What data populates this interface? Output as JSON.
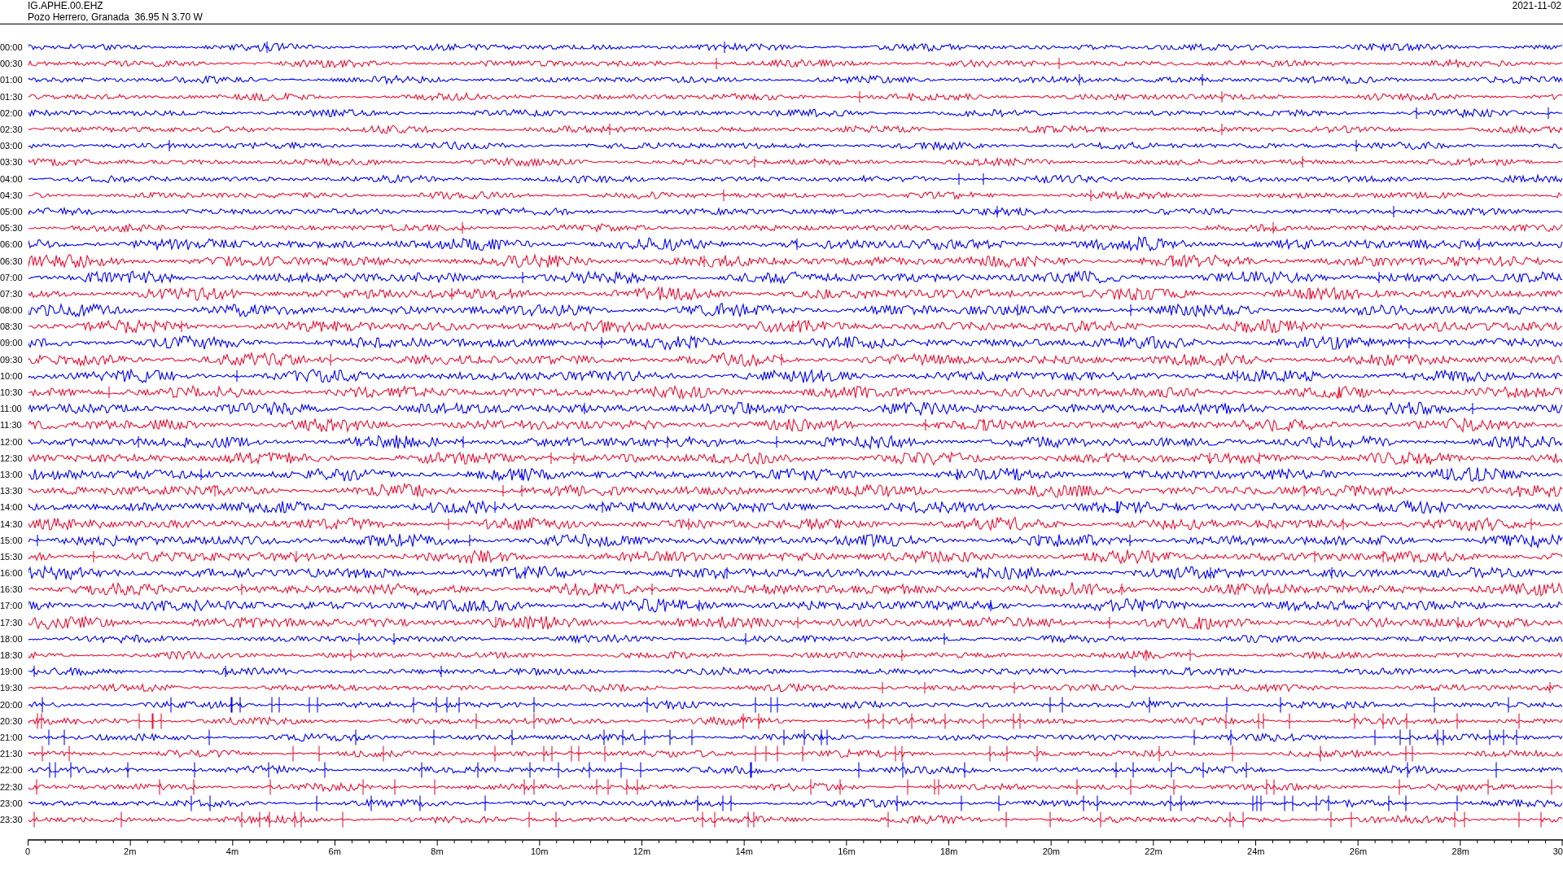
{
  "header": {
    "station": "IG.APHE.00.EHZ",
    "location": "Pozo Herrero, Granada  36.95 N 3.70 W",
    "date": "2021-11-02"
  },
  "traces": [
    {
      "time": "00:00",
      "color": "#0000ff"
    },
    {
      "time": "00:30",
      "color": "#ee1133"
    },
    {
      "time": "01:00",
      "color": "#0000ff"
    },
    {
      "time": "01:30",
      "color": "#ee1133"
    },
    {
      "time": "02:00",
      "color": "#0000ff"
    },
    {
      "time": "02:30",
      "color": "#ee1133"
    },
    {
      "time": "03:00",
      "color": "#0000ff"
    },
    {
      "time": "03:30",
      "color": "#ee1133"
    },
    {
      "time": "04:00",
      "color": "#0000ff"
    },
    {
      "time": "04:30",
      "color": "#ee1133"
    },
    {
      "time": "05:00",
      "color": "#0000ff"
    },
    {
      "time": "05:30",
      "color": "#ee1133"
    },
    {
      "time": "06:00",
      "color": "#0000ff"
    },
    {
      "time": "06:30",
      "color": "#ee1133"
    },
    {
      "time": "07:00",
      "color": "#0000ff"
    },
    {
      "time": "07:30",
      "color": "#ee1133"
    },
    {
      "time": "08:00",
      "color": "#0000ff"
    },
    {
      "time": "08:30",
      "color": "#ee1133"
    },
    {
      "time": "09:00",
      "color": "#0000ff"
    },
    {
      "time": "09:30",
      "color": "#ee1133"
    },
    {
      "time": "10:00",
      "color": "#0000ff"
    },
    {
      "time": "10:30",
      "color": "#ee1133"
    },
    {
      "time": "11:00",
      "color": "#0000ff"
    },
    {
      "time": "11:30",
      "color": "#ee1133"
    },
    {
      "time": "12:00",
      "color": "#0000ff"
    },
    {
      "time": "12:30",
      "color": "#ee1133"
    },
    {
      "time": "13:00",
      "color": "#0000ff"
    },
    {
      "time": "13:30",
      "color": "#ee1133"
    },
    {
      "time": "14:00",
      "color": "#0000ff"
    },
    {
      "time": "14:30",
      "color": "#ee1133"
    },
    {
      "time": "15:00",
      "color": "#0000ff"
    },
    {
      "time": "15:30",
      "color": "#ee1133"
    },
    {
      "time": "16:00",
      "color": "#0000ff"
    },
    {
      "time": "16:30",
      "color": "#ee1133"
    },
    {
      "time": "17:00",
      "color": "#0000ff"
    },
    {
      "time": "17:30",
      "color": "#ee1133"
    },
    {
      "time": "18:00",
      "color": "#0000ff"
    },
    {
      "time": "18:30",
      "color": "#ee1133"
    },
    {
      "time": "19:00",
      "color": "#0000ff"
    },
    {
      "time": "19:30",
      "color": "#ee1133"
    },
    {
      "time": "20:00",
      "color": "#0000ff"
    },
    {
      "time": "20:30",
      "color": "#ee1133"
    },
    {
      "time": "21:00",
      "color": "#0000ff"
    },
    {
      "time": "21:30",
      "color": "#ee1133"
    },
    {
      "time": "22:00",
      "color": "#0000ff"
    },
    {
      "time": "22:30",
      "color": "#ee1133"
    },
    {
      "time": "23:00",
      "color": "#0000ff"
    },
    {
      "time": "23:30",
      "color": "#ee1133"
    }
  ],
  "x_axis": {
    "ticks": [
      "0",
      "2m",
      "4m",
      "6m",
      "8m",
      "10m",
      "12m",
      "14m",
      "16m",
      "18m",
      "20m",
      "22m",
      "24m",
      "26m",
      "28m",
      "30"
    ]
  }
}
